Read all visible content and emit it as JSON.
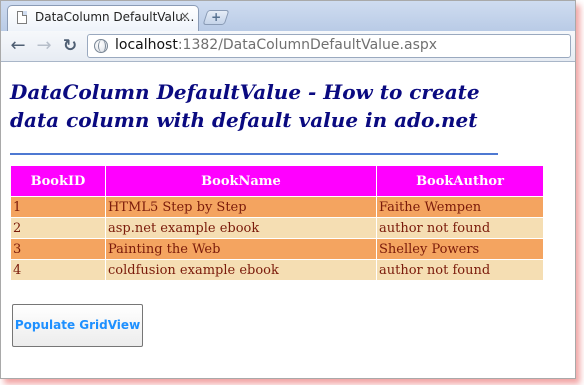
{
  "browser": {
    "tab_title": "DataColumn DefaultValu...",
    "tab_close": "×",
    "new_tab": "+",
    "url_host": "localhost",
    "url_rest": ":1382/DataColumnDefaultValue.aspx",
    "back_icon": "back-arrow-icon",
    "forward_icon": "forward-arrow-icon",
    "reload_icon": "reload-icon",
    "page_icon": "globe-icon"
  },
  "page": {
    "heading_line1": "DataColumn DefaultValue - How to create",
    "heading_line2": "data column with default value in ado.net",
    "heading_color": "#0a0a80",
    "rule_color": "#4e79d2"
  },
  "grid": {
    "header_color": "#ff00ff",
    "row_colors": [
      "#f4a460",
      "#f5deb3"
    ],
    "columns": [
      "BookID",
      "BookName",
      "BookAuthor"
    ],
    "rows": [
      [
        "1",
        "HTML5 Step by Step",
        "Faithe Wempen"
      ],
      [
        "2",
        "asp.net example ebook",
        "author not found"
      ],
      [
        "3",
        "Painting the Web",
        "Shelley Powers"
      ],
      [
        "4",
        "coldfusion example ebook",
        "author not found"
      ]
    ]
  },
  "button": {
    "label": "Populate GridView",
    "color": "#1e90ff"
  }
}
